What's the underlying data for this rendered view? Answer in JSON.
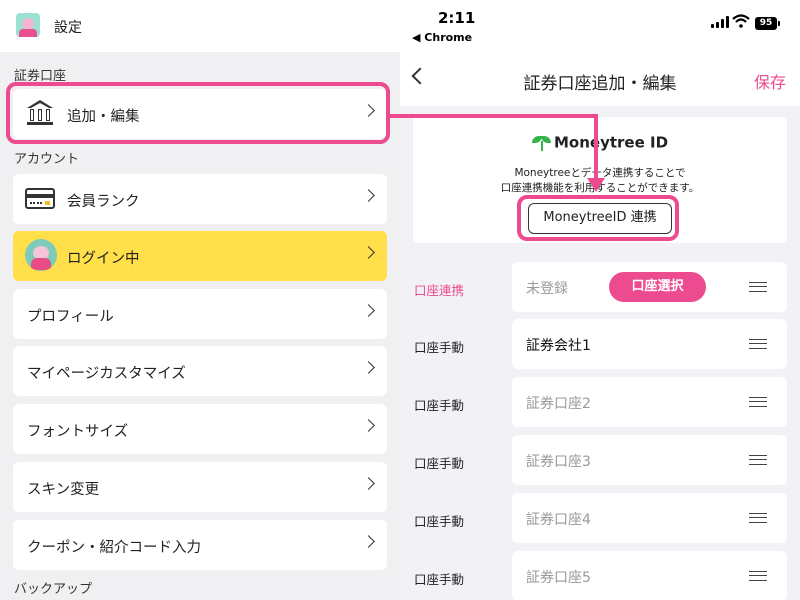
{
  "left": {
    "app_title": "設定",
    "sections": {
      "securities": "証券口座",
      "account": "アカウント",
      "backup": "バックアップ"
    },
    "items": {
      "add_edit": "追加・編集",
      "member_rank": "会員ランク",
      "logged_in": "ログイン中",
      "profile": "プロフィール",
      "mypage_customize": "マイページカスタマイズ",
      "font_size": "フォントサイズ",
      "skin_change": "スキン変更",
      "coupon": "クーポン・紹介コード入力"
    }
  },
  "right": {
    "status": {
      "time": "2:11",
      "back_app": "◀ Chrome",
      "battery": "95"
    },
    "nav": {
      "title": "証券口座追加・編集",
      "save": "保存"
    },
    "moneytree": {
      "logo": "Moneytree ID",
      "desc_line1": "Moneytreeとデータ連携することで",
      "desc_line2": "口座連携機能を利用することができます。",
      "button": "MoneytreeID 連携"
    },
    "rows": [
      {
        "label": "口座連携",
        "value": "未登録",
        "button": "口座選択"
      },
      {
        "label": "口座手動",
        "value": "証券会社1"
      },
      {
        "label": "口座手動",
        "placeholder": "証券口座2"
      },
      {
        "label": "口座手動",
        "placeholder": "証券口座3"
      },
      {
        "label": "口座手動",
        "placeholder": "証券口座4"
      },
      {
        "label": "口座手動",
        "placeholder": "証券口座5"
      }
    ]
  },
  "colors": {
    "accent_pink": "#ec4c8f",
    "highlight_yellow": "#ffdf4a",
    "moneytree_green": "#36b24a"
  },
  "icons": [
    "app-icon",
    "bank-icon",
    "card-icon",
    "avatar-icon",
    "chevron-right-icon",
    "back-arrow-icon",
    "drag-handle-icon",
    "moneytree-leaf-icon",
    "signal-icon",
    "wifi-icon",
    "battery-icon"
  ]
}
